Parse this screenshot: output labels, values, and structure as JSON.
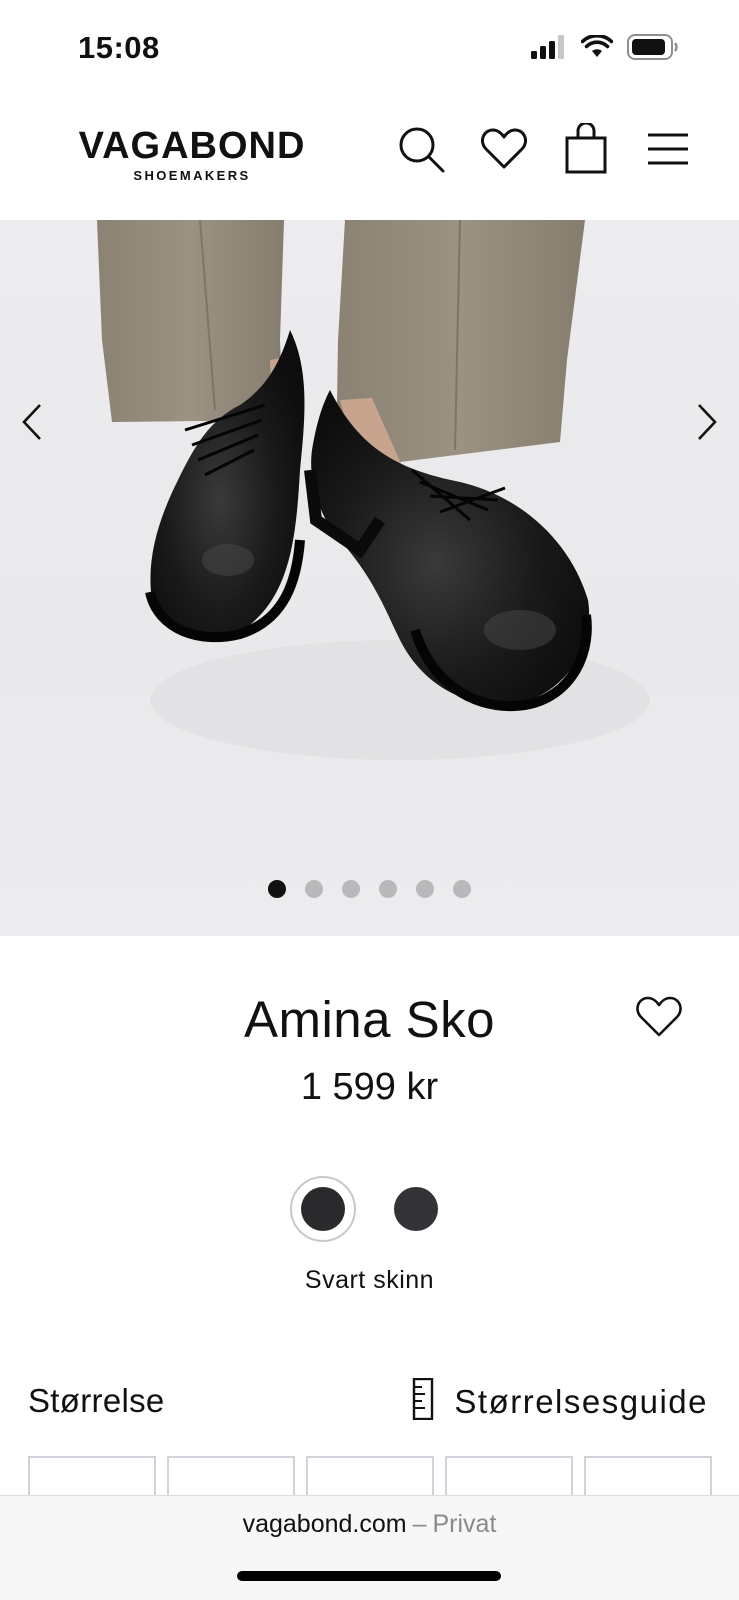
{
  "status_bar": {
    "time": "15:08"
  },
  "header": {
    "brand": "VAGABOND",
    "brand_sub": "SHOEMAKERS",
    "icons": [
      "search-icon",
      "heart-icon",
      "shopping-bag-icon",
      "menu-icon"
    ]
  },
  "gallery": {
    "image_count": 6,
    "active_index": 0,
    "prev_icon": "chevron-left-icon",
    "next_icon": "chevron-right-icon"
  },
  "product": {
    "title": "Amina Sko",
    "price": "1 599 kr",
    "wishlist_icon": "heart-icon",
    "colors": [
      {
        "name": "Svart skinn",
        "hex": "#2a2a2d",
        "selected": true
      },
      {
        "hex": "#333236",
        "selected": false
      }
    ],
    "selected_color_label": "Svart skinn"
  },
  "size": {
    "heading": "Størrelse",
    "guide_label": "Størrelsesguide",
    "guide_icon": "ruler-icon",
    "visible_box_count": 5
  },
  "browser": {
    "domain": "vagabond.com",
    "separator": "–",
    "mode": "Privat"
  },
  "colors": {
    "text": "#111111",
    "muted": "#8a8a8e",
    "dot_inactive": "#b9b9bb",
    "size_border": "#cfd3da"
  }
}
